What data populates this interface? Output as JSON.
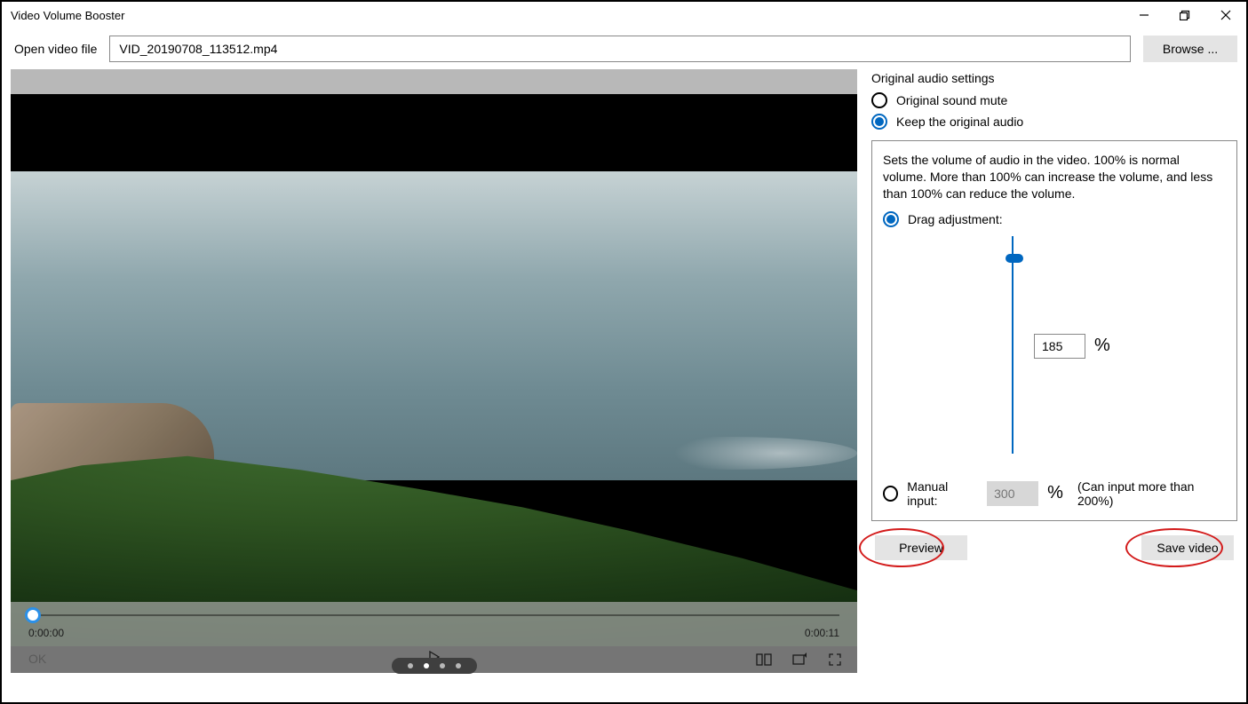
{
  "titlebar": {
    "app_title": "Video Volume Booster"
  },
  "file": {
    "label": "Open video file",
    "value": "VID_20190708_113512.mp4",
    "browse_label": "Browse ..."
  },
  "player": {
    "current_time": "0:00:00",
    "duration": "0:00:11",
    "ok_label": "OK"
  },
  "audio": {
    "section_title": "Original audio settings",
    "opt_mute": "Original sound mute",
    "opt_keep": "Keep the original audio",
    "description": "Sets the volume of audio in the video. 100% is normal volume. More than 100% can increase the volume, and less than 100% can reduce the volume.",
    "drag_label": "Drag adjustment:",
    "drag_value": "185",
    "percent_sign": "%",
    "manual_label": "Manual input:",
    "manual_placeholder": "300",
    "manual_note": "(Can input more than 200%)"
  },
  "actions": {
    "preview": "Preview",
    "save": "Save video"
  }
}
